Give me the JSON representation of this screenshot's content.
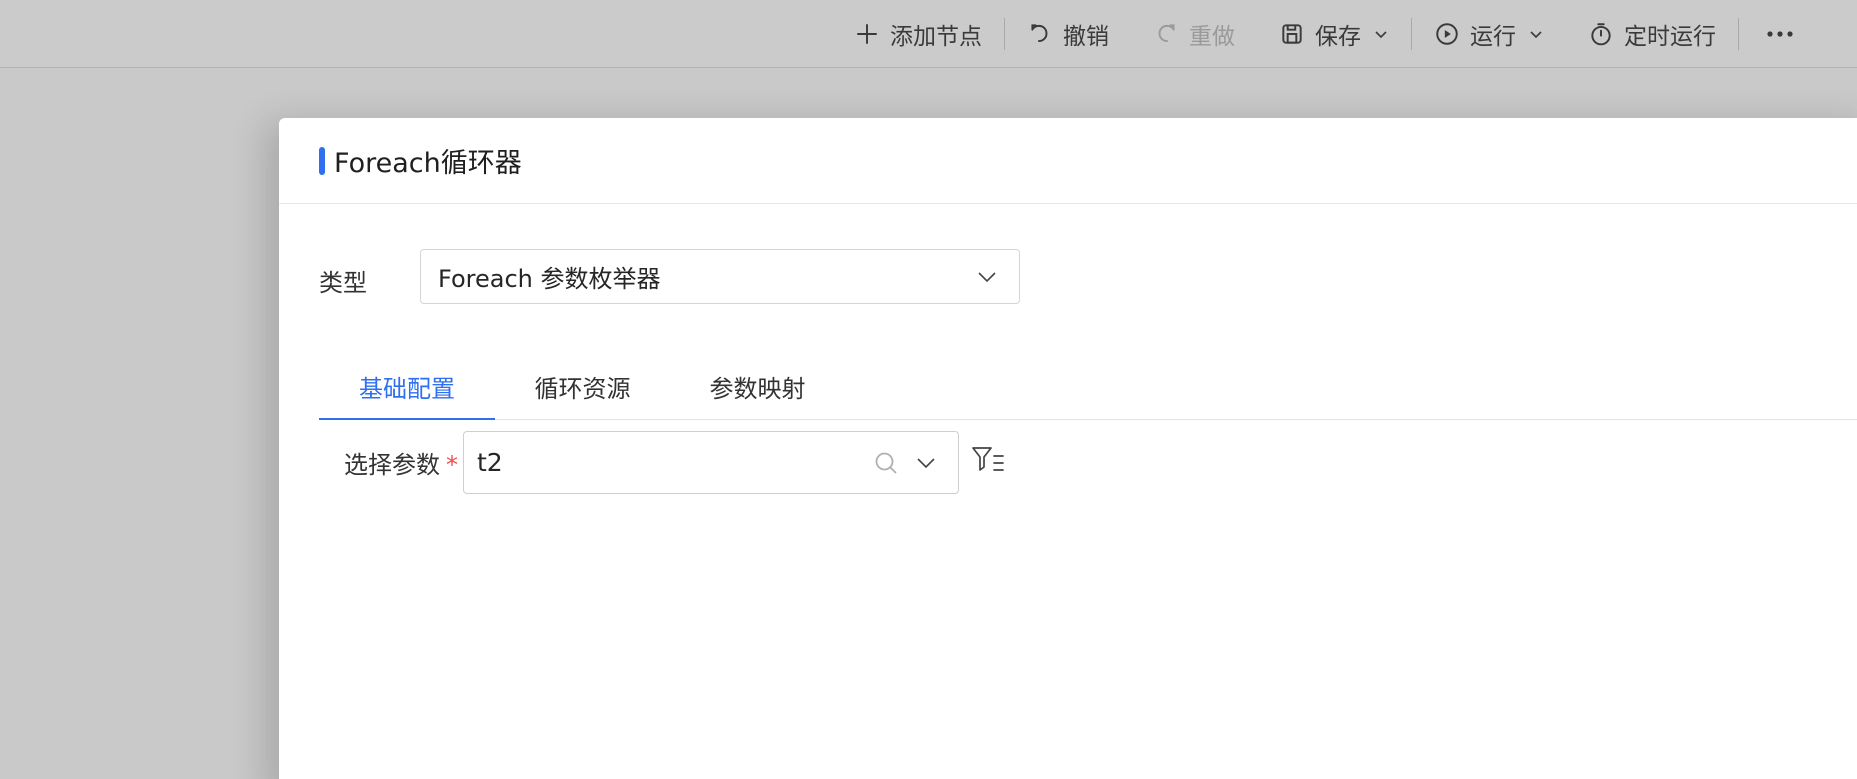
{
  "toolbar": {
    "add_node": "添加节点",
    "undo": "撤销",
    "redo": "重做",
    "save": "保存",
    "run": "运行",
    "scheduled_run": "定时运行"
  },
  "panel": {
    "title": "Foreach循环器",
    "type_label": "类型",
    "type_value": "Foreach 参数枚举器",
    "tabs": [
      "基础配置",
      "循环资源",
      "参数映射"
    ],
    "active_tab": 0,
    "param_label": "选择参数",
    "required_mark": "*",
    "param_value": "t2"
  },
  "colors": {
    "accent": "#2f6ff0",
    "required": "#f24b4b",
    "overlay": "#c9c9c9"
  },
  "icons": [
    "plus-icon",
    "undo-icon",
    "redo-icon",
    "save-icon",
    "chevron-down-icon",
    "play-icon",
    "timer-icon",
    "more-icon",
    "search-icon",
    "filter-icon"
  ]
}
